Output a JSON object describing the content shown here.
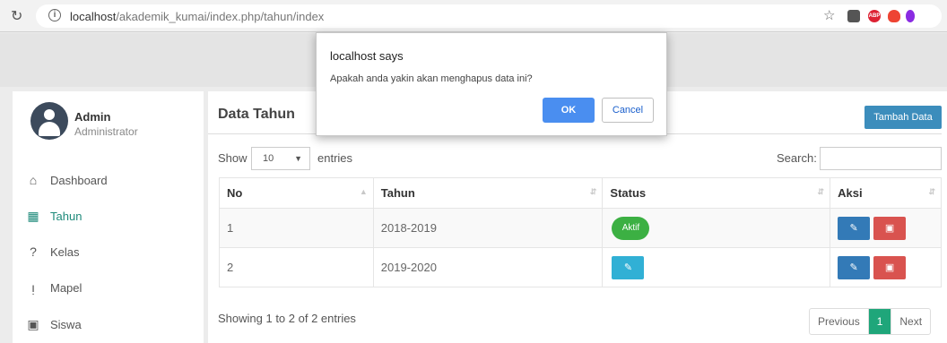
{
  "browser": {
    "url_host": "localhost",
    "url_path": "/akademik_kumai/index.php/tahun/index"
  },
  "user": {
    "name": "Admin",
    "role": "Administrator"
  },
  "sidebar": {
    "items": [
      {
        "label": "Dashboard",
        "icon": "home-icon"
      },
      {
        "label": "Tahun",
        "icon": "calendar-icon",
        "active": true
      },
      {
        "label": "Kelas",
        "icon": "question-icon"
      },
      {
        "label": "Mapel",
        "icon": "info-icon"
      },
      {
        "label": "Siswa",
        "icon": "id-card-icon"
      }
    ]
  },
  "main": {
    "title": "Data Tahun",
    "add_button": "Tambah Data",
    "show_label": "Show",
    "entries_value": "10",
    "entries_label": "entries",
    "search_label": "Search:",
    "columns": [
      "No",
      "Tahun",
      "Status",
      "Aksi"
    ],
    "rows": [
      {
        "no": "1",
        "tahun": "2018-2019",
        "status": "Aktif"
      },
      {
        "no": "2",
        "tahun": "2019-2020",
        "status": ""
      }
    ],
    "showing": "Showing 1 to 2 of 2 entries",
    "pager": {
      "prev": "Previous",
      "current": "1",
      "next": "Next"
    }
  },
  "dialog": {
    "title": "localhost says",
    "message": "Apakah anda yakin akan menghapus data ini?",
    "ok": "OK",
    "cancel": "Cancel"
  },
  "colors": {
    "accent": "#1e8a7a",
    "primary_button": "#3c8dbc",
    "active_badge": "#3cb043",
    "delete_button": "#d9534f",
    "dialog_ok": "#4a8ef0"
  }
}
